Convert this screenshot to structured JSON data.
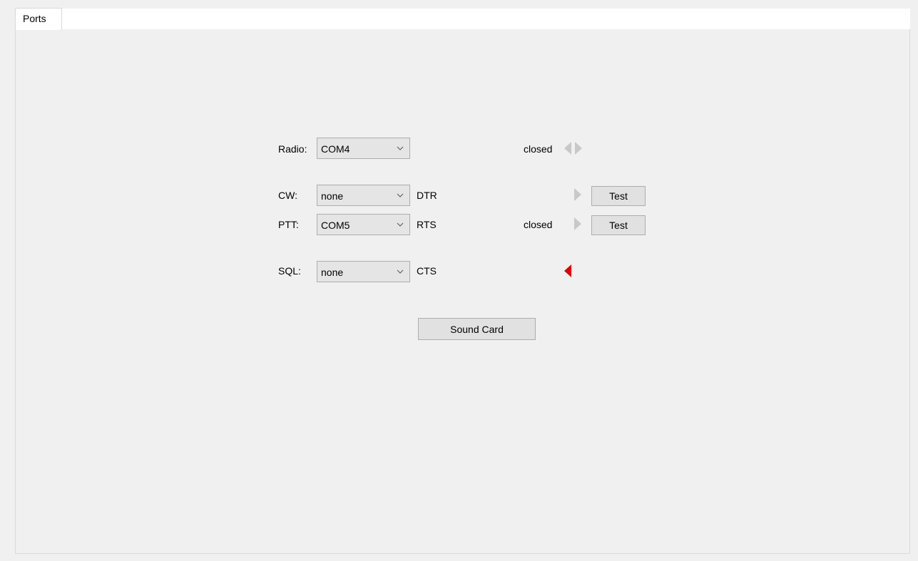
{
  "tabs": [
    {
      "label": "Ports",
      "selected": true
    }
  ],
  "rows": {
    "radio": {
      "label": "Radio:",
      "port": "COM4",
      "status": "closed"
    },
    "cw": {
      "label": "CW:",
      "port": "none",
      "line": "DTR",
      "test_label": "Test"
    },
    "ptt": {
      "label": "PTT:",
      "port": "COM5",
      "line": "RTS",
      "status": "closed",
      "test_label": "Test"
    },
    "sql": {
      "label": "SQL:",
      "port": "none",
      "line": "CTS"
    }
  },
  "sound_card_label": "Sound Card",
  "colors": {
    "indicator_off": "#c8c8c8",
    "indicator_active": "#e00000"
  },
  "icons": {
    "radio_indicator": "bidirectional-arrow-icon",
    "cw_indicator": "right-arrow-icon",
    "ptt_indicator": "right-arrow-icon",
    "sql_indicator": "left-arrow-icon"
  }
}
